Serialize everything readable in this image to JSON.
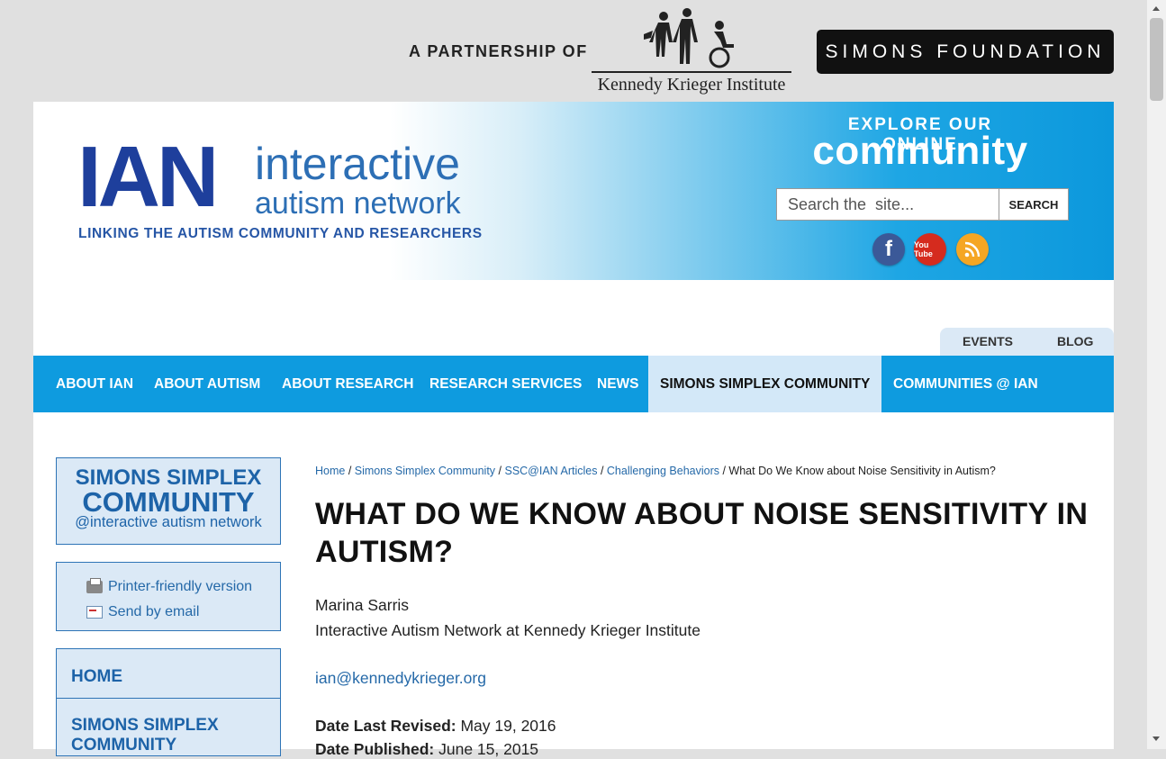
{
  "partner": {
    "text": "A PARTNERSHIP OF",
    "kki": "Kennedy Krieger Institute",
    "simons": "SIMONS FOUNDATION"
  },
  "banner": {
    "logo_letters": "IAN",
    "logo_line1": "interactive",
    "logo_line2": "autism network",
    "tagline": "LINKING THE AUTISM COMMUNITY AND RESEARCHERS",
    "explore_line1": "EXPLORE OUR ONLINE",
    "explore_line2": "community",
    "search_placeholder": "Search the  site...",
    "search_button": "SEARCH",
    "social": {
      "facebook": "f",
      "youtube": "You Tube",
      "rss": "rss-icon"
    }
  },
  "utility_tabs": {
    "events": "EVENTS",
    "blog": "BLOG"
  },
  "nav": [
    "ABOUT IAN",
    "ABOUT AUTISM",
    "ABOUT RESEARCH",
    "RESEARCH SERVICES",
    "NEWS",
    "SIMONS SIMPLEX COMMUNITY",
    "COMMUNITIES @ IAN"
  ],
  "sidebar": {
    "ssc_line1": "SIMONS SIMPLEX",
    "ssc_line2": "COMMUNITY",
    "ssc_line3": "@interactive autism network",
    "printer_friendly": "Printer-friendly version",
    "send_email": "Send by email",
    "nav_home": "HOME",
    "nav_ssc": "SIMONS SIMPLEX COMMUNITY"
  },
  "breadcrumb": {
    "home": "Home",
    "ssc": "Simons Simplex Community",
    "articles": "SSC@IAN Articles",
    "category": "Challenging Behaviors",
    "sep": " / ",
    "current": "What Do We Know about Noise Sensitivity in Autism?"
  },
  "article": {
    "title": "WHAT DO WE KNOW ABOUT NOISE SENSITIVITY IN AUTISM?",
    "author": "Marina Sarris",
    "affiliation": "Interactive Autism Network at Kennedy Krieger Institute",
    "email": "ian@kennedykrieger.org",
    "revised_label": "Date Last Revised:",
    "revised_value": " May 19, 2016",
    "published_label": "Date Published:",
    "published_value": " June 15, 2015"
  },
  "colors": {
    "nav_blue": "#0e9bdf",
    "nav_active": "#d3e8f8",
    "link_blue": "#2569a8",
    "sidebar_bg": "#dbe9f6"
  }
}
